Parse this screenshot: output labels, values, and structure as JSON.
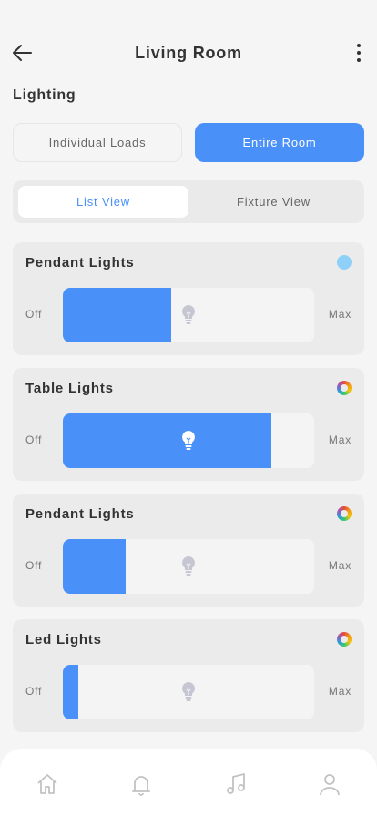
{
  "header": {
    "title": "Living Room"
  },
  "section_label": "Lighting",
  "mode_tabs": {
    "left": "Individual Loads",
    "right": "Entire Room",
    "active": "right"
  },
  "view_tabs": {
    "left": "List View",
    "right": "Fixture View",
    "active": "left"
  },
  "labels": {
    "off": "Off",
    "max": "Max"
  },
  "lights": [
    {
      "name": "Pendant Lights",
      "level": 0.43,
      "color_indicator": "solid",
      "color": "#8fd0f9",
      "bulb_on": false
    },
    {
      "name": "Table Lights",
      "level": 0.83,
      "color_indicator": "multicolor",
      "bulb_on": true
    },
    {
      "name": "Pendant Lights",
      "level": 0.25,
      "color_indicator": "multicolor",
      "bulb_on": false
    },
    {
      "name": "Led Lights",
      "level": 0.06,
      "color_indicator": "multicolor",
      "bulb_on": false
    }
  ],
  "tabbar": {
    "icons": [
      "home-icon",
      "bell-icon",
      "music-icon",
      "profile-icon"
    ]
  },
  "colors": {
    "accent": "#4a90f9",
    "bulb_off": "#c6c6d2",
    "bulb_on": "#ffffff"
  }
}
